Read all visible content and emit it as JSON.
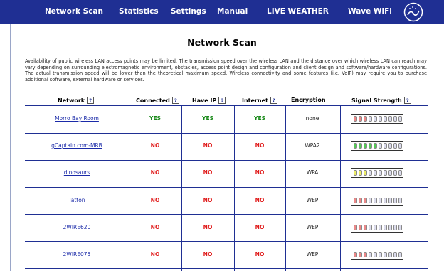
{
  "nav": {
    "items": [
      "Network Scan",
      "Statistics",
      "Settings",
      "Manual",
      "LIVE WEATHER",
      "Wave WiFi"
    ],
    "logo_icon": "wave-logo-icon"
  },
  "page": {
    "title": "Network Scan",
    "intro": "Availability of public wireless LAN access points may be limited. The transmission speed over the wireless LAN and the distance over which wireless LAN can reach may vary depending on surrounding electromagnetic environment, obstacles, access point design and configuration and client design and software/hardware configurations. The actual transmission speed will be lower than the theoretical maximum speed. Wireless connectivity and some features (i.e. VoIP) may require you to purchase additional software, external hardware or services."
  },
  "table": {
    "headers": [
      "Network",
      "Connected",
      "Have IP",
      "Internet",
      "Encryption",
      "Signal Strength"
    ],
    "help_label": "?",
    "rows": [
      {
        "network": "Morro Bay Room",
        "connected": "YES",
        "have_ip": "YES",
        "internet": "YES",
        "encryption": "none",
        "signal": 3,
        "signal_color": "red"
      },
      {
        "network": "gCaptain.com-MRB",
        "connected": "NO",
        "have_ip": "NO",
        "internet": "NO",
        "encryption": "WPA2",
        "signal": 5,
        "signal_color": "green"
      },
      {
        "network": "dinosaurs",
        "connected": "NO",
        "have_ip": "NO",
        "internet": "NO",
        "encryption": "WPA",
        "signal": 3,
        "signal_color": "yellow"
      },
      {
        "network": "Tatton",
        "connected": "NO",
        "have_ip": "NO",
        "internet": "NO",
        "encryption": "WEP",
        "signal": 3,
        "signal_color": "red"
      },
      {
        "network": "2WIRE620",
        "connected": "NO",
        "have_ip": "NO",
        "internet": "NO",
        "encryption": "WEP",
        "signal": 3,
        "signal_color": "red"
      },
      {
        "network": "2WIRE075",
        "connected": "NO",
        "have_ip": "NO",
        "internet": "NO",
        "encryption": "WEP",
        "signal": 3,
        "signal_color": "red"
      }
    ]
  },
  "colors": {
    "nav_bg": "#1f2f93",
    "yes": "#1a8a1a",
    "no": "#e01b1b",
    "signal_red": "#e88",
    "signal_green": "#5c5",
    "signal_yellow": "#ee6",
    "signal_empty": "#dde"
  }
}
